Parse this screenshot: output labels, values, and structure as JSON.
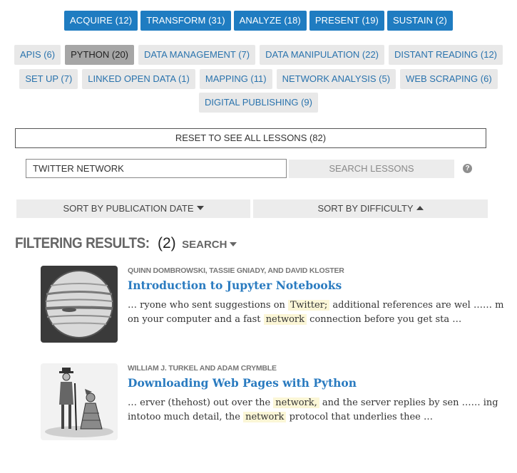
{
  "phases": [
    {
      "label": "ACQUIRE (12)"
    },
    {
      "label": "TRANSFORM (31)"
    },
    {
      "label": "ANALYZE (18)"
    },
    {
      "label": "PRESENT (19)"
    },
    {
      "label": "SUSTAIN (2)"
    }
  ],
  "topics_row1": [
    {
      "label": "APIS (6)"
    },
    {
      "label": "PYTHON (20)"
    },
    {
      "label": "DATA MANAGEMENT (7)"
    },
    {
      "label": "DATA MANIPULATION (22)"
    },
    {
      "label": "DISTANT READING (12)"
    }
  ],
  "topics_row2": [
    {
      "label": "SET UP (7)"
    },
    {
      "label": "LINKED OPEN DATA (1)"
    },
    {
      "label": "MAPPING (11)"
    },
    {
      "label": "NETWORK ANALYSIS (5)"
    },
    {
      "label": "WEB SCRAPING (6)"
    }
  ],
  "topics_row3": [
    {
      "label": "DIGITAL PUBLISHING (9)"
    }
  ],
  "reset_label": "RESET TO SEE ALL LESSONS (82)",
  "search": {
    "value": "TWITTER NETWORK",
    "button_label": "SEARCH LESSONS",
    "help_glyph": "?"
  },
  "sort": {
    "by_date": "SORT BY PUBLICATION DATE",
    "by_difficulty": "SORT BY DIFFICULTY"
  },
  "filter": {
    "label": "FILTERING RESULTS:",
    "count": "(2)",
    "mode": "SEARCH"
  },
  "colors": {
    "phase_blue": "#1f7cc1",
    "link_blue": "#2a7bc0",
    "highlight": "#fbf6d6"
  },
  "results": [
    {
      "authors": "QUINN DOMBROWSKI, TASSIE GNIADY, AND DAVID KLOSTER",
      "title": "Introduction to Jupyter Notebooks",
      "line1_a": "… ryone who sent suggestions on",
      "line1_hl": "Twitter;",
      "line1_b": "additional references are wel …… m",
      "line2_a": "on your computer and a fast",
      "line2_hl": "network",
      "line2_b": "connection before you get sta …"
    },
    {
      "authors": "WILLIAM J. TURKEL AND ADAM CRYMBLE",
      "title": "Downloading Web Pages with Python",
      "line1_a": "… erver (thehost) out over the",
      "line1_hl": "network,",
      "line1_b": "and the server replies by sen …… ing",
      "line2_a": "intotoo much detail, the",
      "line2_hl": "network",
      "line2_b": "protocol that underlies thee …"
    }
  ]
}
